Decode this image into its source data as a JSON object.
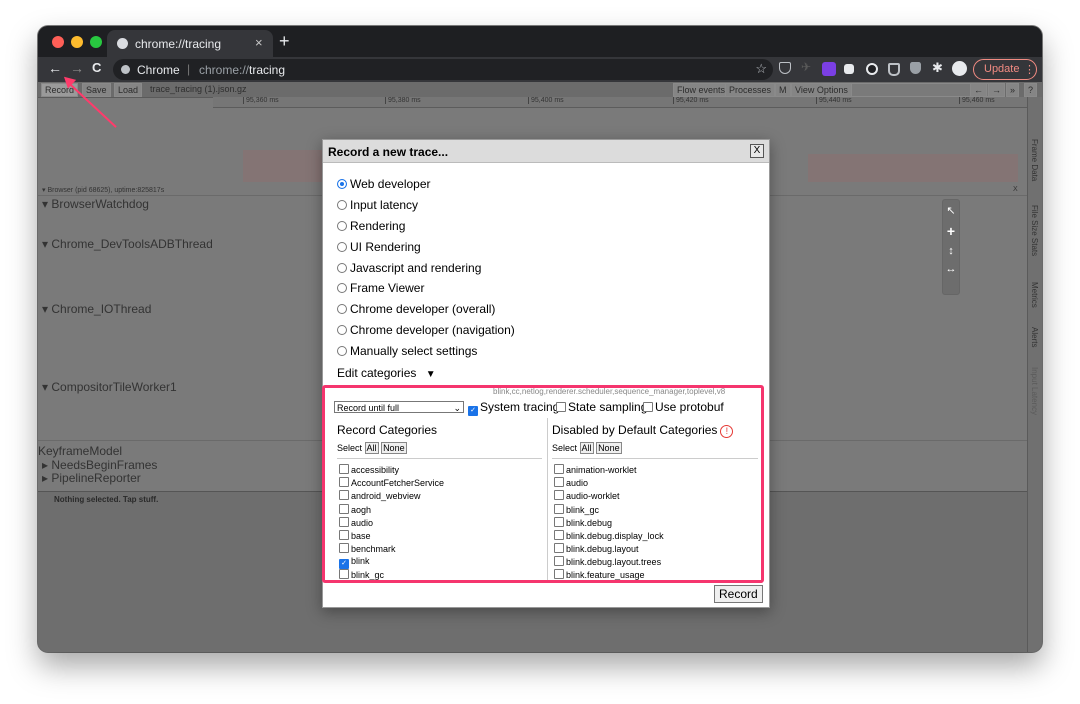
{
  "browser": {
    "tab_title": "chrome://tracing",
    "tab_close": "×",
    "new_tab": "+",
    "nav_back": "←",
    "nav_forward": "→",
    "nav_reload": "C",
    "site_name": "Chrome",
    "url_prefix": "chrome://",
    "url_path": "tracing",
    "bookmark_star": "☆",
    "update_label": "Update",
    "update_more": "⋮",
    "traffic_colors": [
      "#ff5f57",
      "#febc2e",
      "#28c840"
    ],
    "extension_icons": [
      "pocket-icon",
      "rocket-icon",
      "purple-extension-icon",
      "dark-extension-icon",
      "circle-extension-icon",
      "shield-extension-icon",
      "ublock-icon",
      "puzzle-icon",
      "profile-icon"
    ]
  },
  "tracing": {
    "buttons": {
      "record": "Record",
      "save": "Save",
      "load": "Load"
    },
    "filename": "trace_tracing (1).json.gz",
    "right_buttons": {
      "flow_events": "Flow events",
      "processes": "Processes",
      "m": "M",
      "view_options": "View Options"
    },
    "nav_arrows": [
      "←",
      "→",
      "»",
      "?"
    ],
    "ruler_ticks": [
      "95,360 ms",
      "95,380 ms",
      "95,400 ms",
      "95,420 ms",
      "95,440 ms",
      "95,460 ms"
    ],
    "process_header": "▾ Browser (pid 68625), uptime:825817s",
    "process_close": "X",
    "threads": [
      "BrowserWatchdog",
      "Chrome_DevToolsADBThread",
      "Chrome_IOThread",
      "CompositorTileWorker1"
    ],
    "bottom_tracks": [
      "KeyframeModel",
      "NeedsBeginFrames",
      "PipelineReporter"
    ],
    "side_tabs": [
      "Frame Data",
      "File Size Stats",
      "Metrics",
      "Alerts",
      "Input Latency"
    ],
    "status": "Nothing selected. Tap stuff.",
    "zoom_controls": [
      "↖",
      "+",
      "↕",
      "↔"
    ]
  },
  "dialog": {
    "title": "Record a new trace...",
    "close": "X",
    "presets": [
      {
        "label": "Web developer",
        "checked": true
      },
      {
        "label": "Input latency",
        "checked": false
      },
      {
        "label": "Rendering",
        "checked": false
      },
      {
        "label": "UI Rendering",
        "checked": false
      },
      {
        "label": "Javascript and rendering",
        "checked": false
      },
      {
        "label": "Frame Viewer",
        "checked": false
      },
      {
        "label": "Chrome developer (overall)",
        "checked": false
      },
      {
        "label": "Chrome developer (navigation)",
        "checked": false
      },
      {
        "label": "Manually select settings",
        "checked": false
      }
    ],
    "edit_categories": "Edit categories",
    "edit_chevron": "▼",
    "category_string": "blink,cc,netlog,renderer.scheduler,sequence_manager,toplevel,v8",
    "record_mode": "Record until full",
    "record_mode_chevron": "⌄",
    "options": [
      {
        "label": "System tracing",
        "checked": true
      },
      {
        "label": "State sampling",
        "checked": false
      },
      {
        "label": "Use protobuf",
        "checked": false
      }
    ],
    "record_categories": {
      "heading": "Record Categories",
      "select_label": "Select",
      "all": "All",
      "none": "None",
      "items": [
        {
          "label": "accessibility",
          "checked": false
        },
        {
          "label": "AccountFetcherService",
          "checked": false
        },
        {
          "label": "android_webview",
          "checked": false
        },
        {
          "label": "aogh",
          "checked": false
        },
        {
          "label": "audio",
          "checked": false
        },
        {
          "label": "base",
          "checked": false
        },
        {
          "label": "benchmark",
          "checked": false
        },
        {
          "label": "blink",
          "checked": true
        },
        {
          "label": "blink_gc",
          "checked": false
        }
      ]
    },
    "disabled_categories": {
      "heading": "Disabled by Default Categories",
      "warning": "!",
      "select_label": "Select",
      "all": "All",
      "none": "None",
      "items": [
        {
          "label": "animation-worklet",
          "checked": false
        },
        {
          "label": "audio",
          "checked": false
        },
        {
          "label": "audio-worklet",
          "checked": false
        },
        {
          "label": "blink_gc",
          "checked": false
        },
        {
          "label": "blink.debug",
          "checked": false
        },
        {
          "label": "blink.debug.display_lock",
          "checked": false
        },
        {
          "label": "blink.debug.layout",
          "checked": false
        },
        {
          "label": "blink.debug.layout.trees",
          "checked": false
        },
        {
          "label": "blink.feature_usage",
          "checked": false
        }
      ]
    },
    "record_button": "Record"
  },
  "colors": {
    "highlight": "#f5356e",
    "accent": "#1a73e8",
    "update": "#f28b82"
  }
}
